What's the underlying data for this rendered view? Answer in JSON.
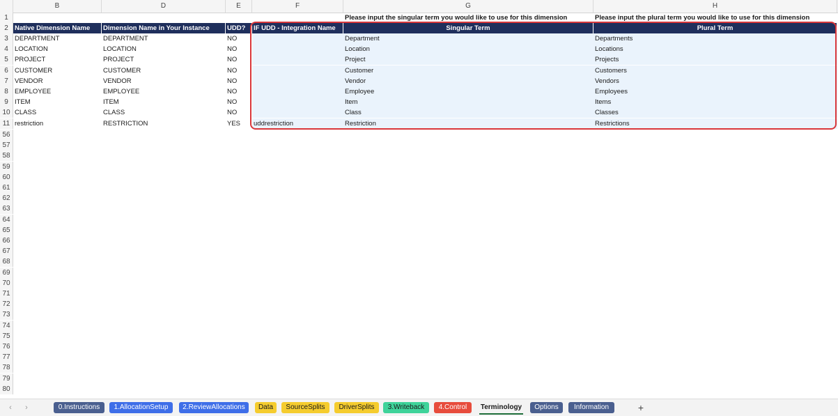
{
  "columns": [
    "B",
    "D",
    "E",
    "F",
    "G",
    "H"
  ],
  "row1": {
    "num": "1",
    "g_note": "Please input the singular term you would like to use for this dimension",
    "h_note": "Please input the plural term you would like to use for this dimension"
  },
  "headers": {
    "num": "2",
    "native": "Native Dimension Name",
    "instance": "Dimension Name in Your Instance",
    "udd": "UDD?",
    "integration": "IF UDD - Integration Name",
    "singular": "Singular Term",
    "plural": "Plural Term"
  },
  "rows": [
    {
      "num": "3",
      "native": "DEPARTMENT",
      "instance": "DEPARTMENT",
      "udd": "NO",
      "integration": "",
      "singular": "Department",
      "plural": "Departments"
    },
    {
      "num": "4",
      "native": "LOCATION",
      "instance": "LOCATION",
      "udd": "NO",
      "integration": "",
      "singular": "Location",
      "plural": "Locations"
    },
    {
      "num": "5",
      "native": "PROJECT",
      "instance": "PROJECT",
      "udd": "NO",
      "integration": "",
      "singular": "Project",
      "plural": "Projects"
    },
    {
      "num": "6",
      "native": "CUSTOMER",
      "instance": "CUSTOMER",
      "udd": "NO",
      "integration": "",
      "singular": "Customer",
      "plural": "Customers"
    },
    {
      "num": "7",
      "native": "VENDOR",
      "instance": "VENDOR",
      "udd": "NO",
      "integration": "",
      "singular": "Vendor",
      "plural": "Vendors"
    },
    {
      "num": "8",
      "native": "EMPLOYEE",
      "instance": "EMPLOYEE",
      "udd": "NO",
      "integration": "",
      "singular": "Employee",
      "plural": "Employees"
    },
    {
      "num": "9",
      "native": "ITEM",
      "instance": "ITEM",
      "udd": "NO",
      "integration": "",
      "singular": "Item",
      "plural": "Items"
    },
    {
      "num": "10",
      "native": "CLASS",
      "instance": "CLASS",
      "udd": "NO",
      "integration": "",
      "singular": "Class",
      "plural": "Classes"
    },
    {
      "num": "11",
      "native": "restriction",
      "instance": "RESTRICTION",
      "udd": "YES",
      "integration": "uddrestriction",
      "singular": "Restriction",
      "plural": "Restrictions"
    }
  ],
  "empty_rows": [
    "56",
    "57",
    "58",
    "59",
    "60",
    "61",
    "62",
    "63",
    "64",
    "65",
    "66",
    "67",
    "68",
    "69",
    "70",
    "71",
    "72",
    "73",
    "74",
    "75",
    "76",
    "77",
    "78",
    "79",
    "80"
  ],
  "sheet_tabs": [
    {
      "label": "0.Instructions",
      "color": "#4a5f8f",
      "text": "#ffffff"
    },
    {
      "label": "1.AllocationSetup",
      "color": "#3e6ee8",
      "text": "#ffffff"
    },
    {
      "label": "2.ReviewAllocations",
      "color": "#3e6ee8",
      "text": "#ffffff"
    },
    {
      "label": "Data",
      "color": "#f5cc2e",
      "text": "#1a1a1a"
    },
    {
      "label": "SourceSplits",
      "color": "#f5cc2e",
      "text": "#1a1a1a"
    },
    {
      "label": "DriverSplits",
      "color": "#f5cc2e",
      "text": "#1a1a1a"
    },
    {
      "label": "3.Writeback",
      "color": "#3ed39a",
      "text": "#1a1a1a"
    },
    {
      "label": "4.Control",
      "color": "#e74c3c",
      "text": "#ffffff"
    },
    {
      "label": "Terminology",
      "color": "transparent",
      "text": "#1a1a1a",
      "active": true
    },
    {
      "label": "Options",
      "color": "#4a5f8f",
      "text": "#ffffff"
    },
    {
      "label": "Information",
      "color": "#4a5f8f",
      "text": "#ffffff"
    }
  ],
  "tab_nav": {
    "prev": "‹",
    "next": "›",
    "add": "+"
  },
  "colors": {
    "header_bg": "#1f2f5c",
    "highlight_border": "#d9373a",
    "input_fill": "#eaf3fc"
  }
}
